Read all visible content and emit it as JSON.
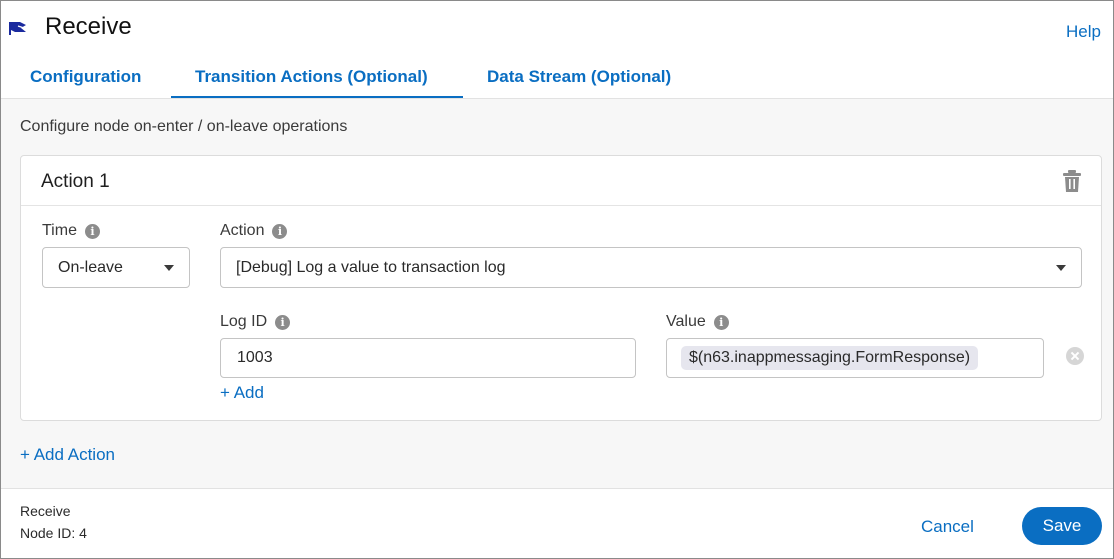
{
  "header": {
    "title": "Receive",
    "help_label": "Help",
    "tabs": [
      {
        "label": "Configuration",
        "active": false
      },
      {
        "label": "Transition Actions (Optional)",
        "active": true
      },
      {
        "label": "Data Stream (Optional)",
        "active": false
      }
    ]
  },
  "main": {
    "description": "Configure node on-enter / on-leave operations",
    "action_card": {
      "title": "Action 1",
      "time_label": "Time",
      "time_value": "On-leave",
      "action_label": "Action",
      "action_value": "[Debug] Log a value to transaction log",
      "log_id_label": "Log ID",
      "log_id_value": "1003",
      "value_label": "Value",
      "value_chip": "$(n63.inappmessaging.FormResponse)",
      "add_label": "+ Add"
    },
    "add_action_label": "+ Add Action"
  },
  "footer": {
    "node_name": "Receive",
    "node_id": "Node ID: 4",
    "cancel_label": "Cancel",
    "save_label": "Save"
  },
  "colors": {
    "accent": "#0a6ec2",
    "chip_bg": "#e6e6ee",
    "content_bg": "#f7f7f7"
  },
  "icons": [
    "flag-icon",
    "trash-icon",
    "info-icon",
    "chevron-down-icon",
    "clear-icon"
  ]
}
